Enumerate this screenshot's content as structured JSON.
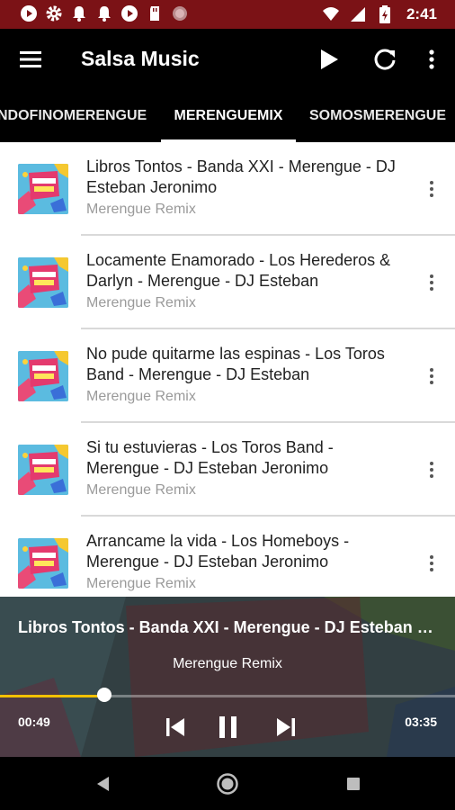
{
  "status_bar": {
    "time": "2:41",
    "left_icons": [
      "youtube-icon",
      "settings-icon",
      "notification-bell-icon",
      "notification-bell-icon",
      "youtube-icon",
      "sd-card-icon",
      "record-icon"
    ],
    "right_icons": [
      "wifi-icon",
      "signal-icon",
      "battery-icon"
    ],
    "background": "#7b1216"
  },
  "app_bar": {
    "title": "Salsa Music",
    "actions": [
      "play-icon",
      "refresh-icon",
      "more-vert-icon"
    ]
  },
  "tabs": [
    {
      "label": "NDOFINOMERENGUE",
      "selected": false
    },
    {
      "label": "MERENGUEMIX",
      "selected": true
    },
    {
      "label": "SOMOSMERENGUE",
      "selected": false
    }
  ],
  "tracks": [
    {
      "title": "Libros Tontos - Banda XXI - Merengue - DJ Esteban Jeronimo",
      "subtitle": "Merengue Remix"
    },
    {
      "title": "Locamente Enamorado - Los Herederos & Darlyn - Merengue - DJ Esteban",
      "subtitle": "Merengue Remix"
    },
    {
      "title": "No pude quitarme las espinas - Los Toros Band - Merengue - DJ Esteban",
      "subtitle": "Merengue Remix"
    },
    {
      "title": "Si tu estuvieras - Los Toros Band - Merengue - DJ Esteban Jeronimo",
      "subtitle": "Merengue Remix"
    },
    {
      "title": "Arrancame la vida - Los Homeboys - Merengue - DJ Esteban Jeronimo",
      "subtitle": "Merengue Remix"
    }
  ],
  "player": {
    "title": "Libros Tontos - Banda XXI - Merengue - DJ Esteban Jeronimo",
    "subtitle": "Merengue Remix",
    "elapsed": "00:49",
    "total": "03:35",
    "progress_fraction": 0.23,
    "controls": [
      "skip-previous-icon",
      "pause-icon",
      "skip-next-icon"
    ],
    "accent": "#f2c100"
  },
  "nav_bar": {
    "buttons": [
      "back-icon",
      "home-icon",
      "recents-icon"
    ]
  }
}
